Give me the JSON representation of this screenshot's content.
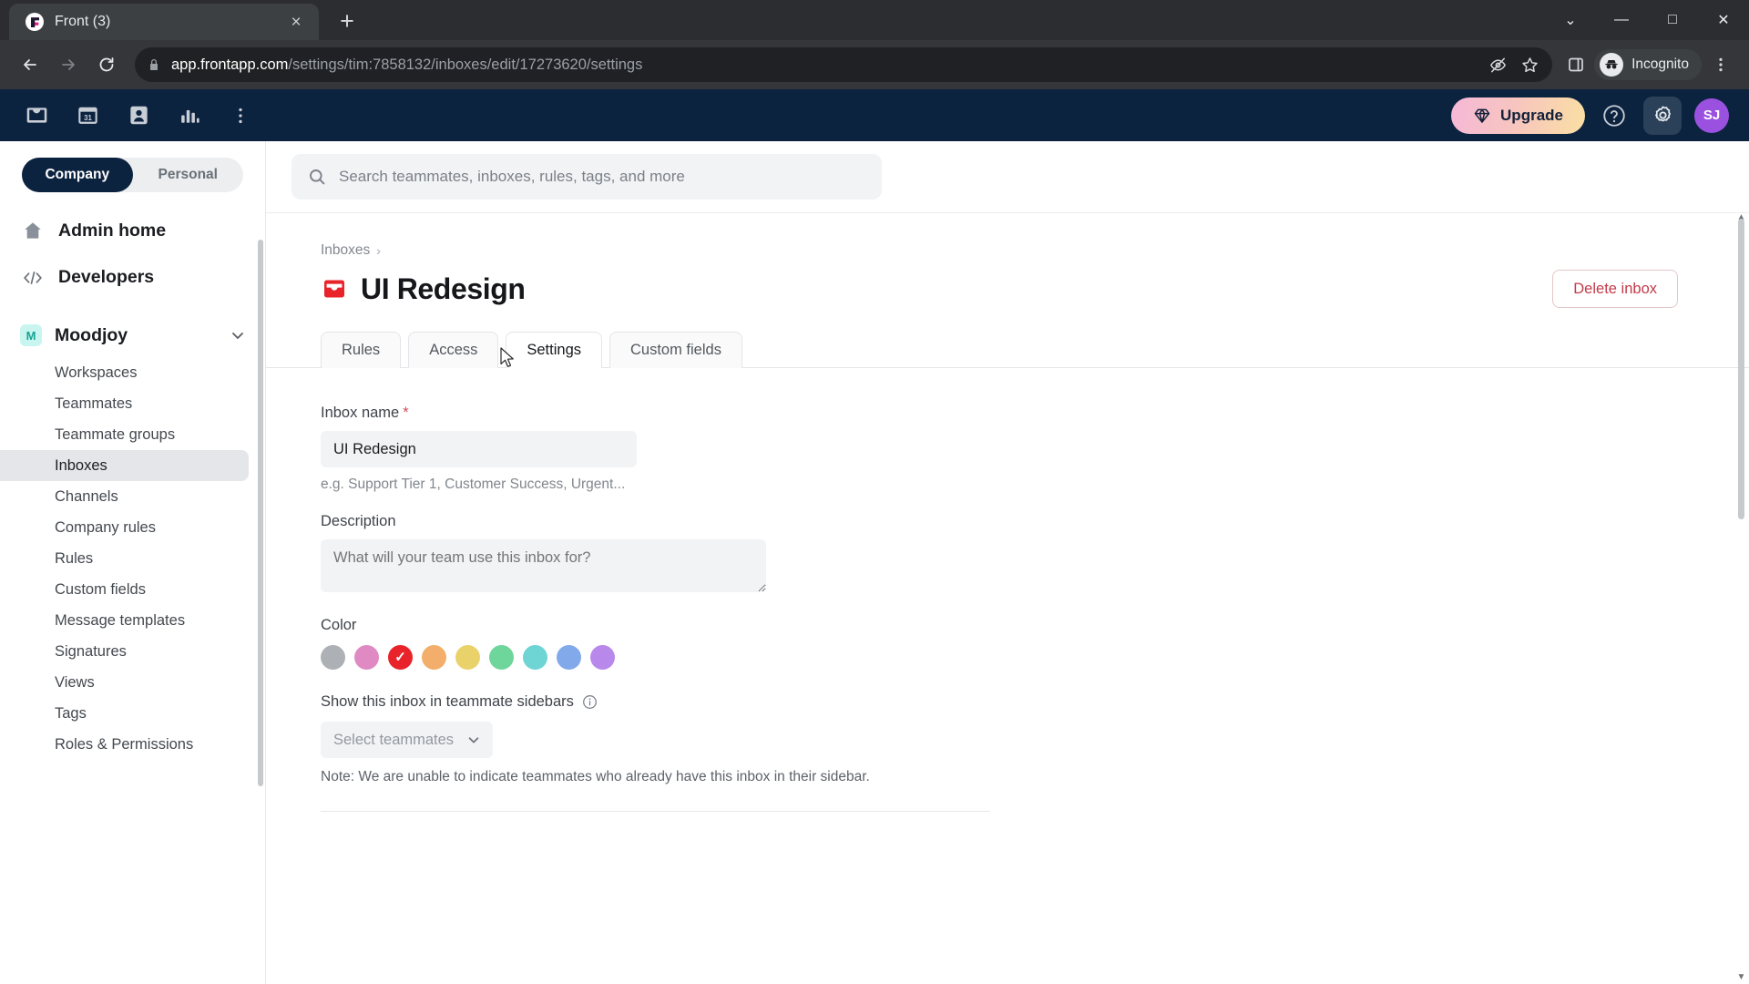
{
  "browser": {
    "tab": {
      "title": "Front (3)",
      "favicon": "front-logo-icon",
      "close": "×"
    },
    "new_tab_label": "+",
    "window_controls": {
      "minimize_chevron": "⌄",
      "minimize": "—",
      "maximize": "□",
      "close": "✕"
    },
    "url": {
      "host": "app.frontapp.com",
      "path": "/settings/tim:7858132/inboxes/edit/17273620/settings"
    },
    "profile_label": "Incognito",
    "icons": [
      "back-icon",
      "forward-icon",
      "reload-icon",
      "lock-icon",
      "hide-tracking-icon",
      "bookmark-star-icon",
      "side-panel-icon",
      "incognito-icon",
      "browser-menu-icon"
    ]
  },
  "topnav": {
    "icons": [
      "inbox-icon",
      "calendar-icon",
      "contacts-icon",
      "analytics-icon",
      "more-options-icon"
    ],
    "calendar_day": "31",
    "upgrade_label": "Upgrade",
    "upgrade_icon": "diamond-icon",
    "help_icon": "help-circle-icon",
    "settings_icon": "gear-icon",
    "avatar_initials": "SJ",
    "avatar_color": "#9b51e0",
    "background_color": "#0c2340"
  },
  "sidebar": {
    "segmented": {
      "options": [
        "Company",
        "Personal"
      ],
      "selected": "Company"
    },
    "major_items": [
      {
        "label": "Admin home",
        "icon": "home-icon"
      },
      {
        "label": "Developers",
        "icon": "code-icon"
      }
    ],
    "team": {
      "badge": "M",
      "name": "Moodjoy",
      "chevron": "chevron-down-icon",
      "badge_bg": "#c9f5f0",
      "badge_fg": "#16a394"
    },
    "items": [
      {
        "label": "Workspaces",
        "active": false
      },
      {
        "label": "Teammates",
        "active": false
      },
      {
        "label": "Teammate groups",
        "active": false
      },
      {
        "label": "Inboxes",
        "active": true
      },
      {
        "label": "Channels",
        "active": false
      },
      {
        "label": "Company rules",
        "active": false
      },
      {
        "label": "Rules",
        "active": false
      },
      {
        "label": "Custom fields",
        "active": false
      },
      {
        "label": "Message templates",
        "active": false
      },
      {
        "label": "Signatures",
        "active": false
      },
      {
        "label": "Views",
        "active": false
      },
      {
        "label": "Tags",
        "active": false
      },
      {
        "label": "Roles & Permissions",
        "active": false
      }
    ]
  },
  "search": {
    "placeholder": "Search teammates, inboxes, rules, tags, and more",
    "icon": "search-icon"
  },
  "page": {
    "breadcrumb": {
      "parent": "Inboxes",
      "separator": "›"
    },
    "title": "UI Redesign",
    "title_icon": "inbox-icon",
    "title_icon_color": "#e8232a",
    "delete_label": "Delete inbox",
    "tabs": [
      {
        "label": "Rules",
        "active": false
      },
      {
        "label": "Access",
        "active": false
      },
      {
        "label": "Settings",
        "active": true
      },
      {
        "label": "Custom fields",
        "active": false
      }
    ]
  },
  "form": {
    "inbox_name": {
      "label": "Inbox name",
      "required_marker": "*",
      "value": "UI Redesign",
      "helper": "e.g. Support Tier 1, Customer Success, Urgent..."
    },
    "description": {
      "label": "Description",
      "value": "",
      "placeholder": "What will your team use this inbox for?"
    },
    "color": {
      "label": "Color",
      "selected_index": 2,
      "check_glyph": "✓",
      "swatches": [
        {
          "name": "gray",
          "hex": "#adb1b5"
        },
        {
          "name": "pink",
          "hex": "#e08ac4"
        },
        {
          "name": "red",
          "hex": "#e8232a"
        },
        {
          "name": "orange",
          "hex": "#f2ae6a"
        },
        {
          "name": "yellow",
          "hex": "#ead26b"
        },
        {
          "name": "green",
          "hex": "#6ed59b"
        },
        {
          "name": "teal",
          "hex": "#6fd4d4"
        },
        {
          "name": "blue",
          "hex": "#82aaea"
        },
        {
          "name": "purple",
          "hex": "#b888ea"
        }
      ]
    },
    "sidebar_visibility": {
      "label": "Show this inbox in teammate sidebars",
      "info_icon": "info-icon",
      "select_placeholder": "Select teammates",
      "chevron": "chevron-down-icon",
      "note": "Note: We are unable to indicate teammates who already have this inbox in their sidebar."
    }
  }
}
